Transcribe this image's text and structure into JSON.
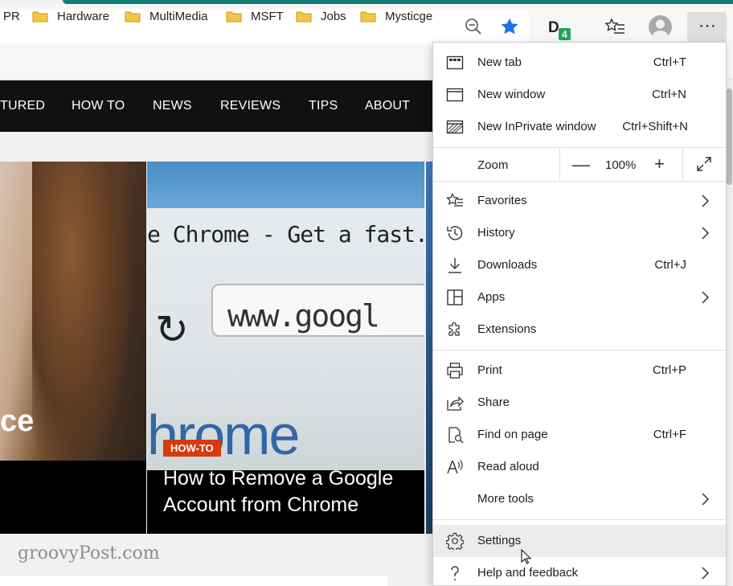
{
  "toolbar": {
    "extension_badge": "4",
    "menu_button_label": "⋯"
  },
  "bookmarks": [
    {
      "label": "PR"
    },
    {
      "label": "Hardware"
    },
    {
      "label": "MultiMedia"
    },
    {
      "label": "MSFT"
    },
    {
      "label": "Jobs"
    },
    {
      "label": "Mysticge"
    }
  ],
  "site_nav": [
    "TURED",
    "HOW TO",
    "NEWS",
    "REVIEWS",
    "TIPS",
    "ABOUT"
  ],
  "cards": {
    "left_overlay_text": "ce",
    "mid_screen_title": "e Chrome - Get a fast...",
    "mid_screen_url": "www.googl",
    "mid_screen_word": "hrome",
    "tag": "HOW-TO",
    "headline": "How to Remove a Google Account from Chrome"
  },
  "watermark": "groovyPost.com",
  "menu": {
    "items_top": [
      {
        "label": "New tab",
        "shortcut": "Ctrl+T",
        "icon": "new-tab-icon"
      },
      {
        "label": "New window",
        "shortcut": "Ctrl+N",
        "icon": "new-window-icon"
      },
      {
        "label": "New InPrivate window",
        "shortcut": "Ctrl+Shift+N",
        "icon": "inprivate-icon"
      }
    ],
    "zoom": {
      "label": "Zoom",
      "minus": "—",
      "value": "100%",
      "plus": "+"
    },
    "items_mid": [
      {
        "label": "Favorites",
        "shortcut": "",
        "icon": "favorites-icon"
      },
      {
        "label": "History",
        "shortcut": "",
        "icon": "history-icon"
      },
      {
        "label": "Downloads",
        "shortcut": "Ctrl+J",
        "icon": "downloads-icon"
      },
      {
        "label": "Apps",
        "shortcut": "",
        "icon": "apps-icon"
      },
      {
        "label": "Extensions",
        "shortcut": "",
        "icon": "extensions-icon"
      }
    ],
    "items_low": [
      {
        "label": "Print",
        "shortcut": "Ctrl+P",
        "icon": "print-icon"
      },
      {
        "label": "Share",
        "shortcut": "",
        "icon": "share-icon"
      },
      {
        "label": "Find on page",
        "shortcut": "Ctrl+F",
        "icon": "find-icon"
      },
      {
        "label": "Read aloud",
        "shortcut": "",
        "icon": "read-aloud-icon"
      },
      {
        "label": "More tools",
        "shortcut": "",
        "icon": ""
      }
    ],
    "items_bottom": [
      {
        "label": "Settings",
        "icon": "settings-icon"
      },
      {
        "label": "Help and feedback",
        "icon": "help-icon"
      }
    ]
  },
  "colors": {
    "accent_teal": "#0f7e75",
    "star_blue": "#1a73e8",
    "tag_orange": "#d43b0f",
    "nav_black": "#111111"
  }
}
